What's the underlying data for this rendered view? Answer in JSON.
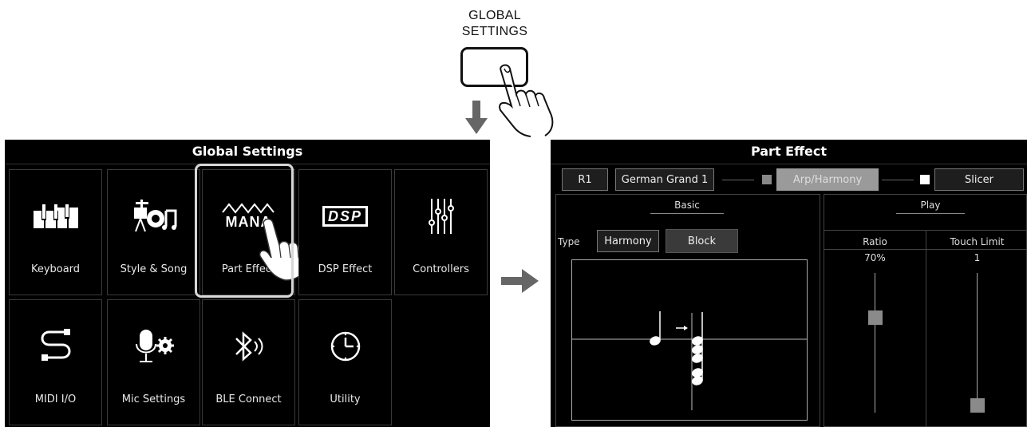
{
  "hardware": {
    "label_line1": "GLOBAL",
    "label_line2": "SETTINGS"
  },
  "global_settings": {
    "title": "Global Settings",
    "tiles": [
      {
        "label": "Keyboard",
        "icon": "keyboard-icon"
      },
      {
        "label": "Style & Song",
        "icon": "drums-icon"
      },
      {
        "label": "Part Effect",
        "icon": "mana-logo-icon"
      },
      {
        "label": "DSP Effect",
        "icon": "dsp-icon"
      },
      {
        "label": "Controllers",
        "icon": "sliders-icon"
      },
      {
        "label": "MIDI I/O",
        "icon": "cable-icon"
      },
      {
        "label": "Mic Settings",
        "icon": "mic-gear-icon"
      },
      {
        "label": "BLE Connect",
        "icon": "bluetooth-icon"
      },
      {
        "label": "Utility",
        "icon": "clock-icon"
      }
    ],
    "logo_text": "MANA",
    "dsp_text": "DSP"
  },
  "part_effect": {
    "title": "Part Effect",
    "part": "R1",
    "voice": "German Grand 1",
    "arp_label": "Arp/Harmony",
    "slicer_label": "Slicer",
    "basic_header": "Basic",
    "type_label": "Type",
    "type_value": "Harmony",
    "mode_value": "Block",
    "play_header": "Play",
    "ratio_label": "Ratio",
    "ratio_value": "70%",
    "ratio_level": 0.7,
    "touch_label": "Touch Limit",
    "touch_value": "1",
    "touch_level": 0.0
  },
  "colors": {
    "screen_bg": "#000000",
    "highlight": "#d7d7d7",
    "active_tab": "#9a9a9a",
    "arrow": "#666666"
  }
}
